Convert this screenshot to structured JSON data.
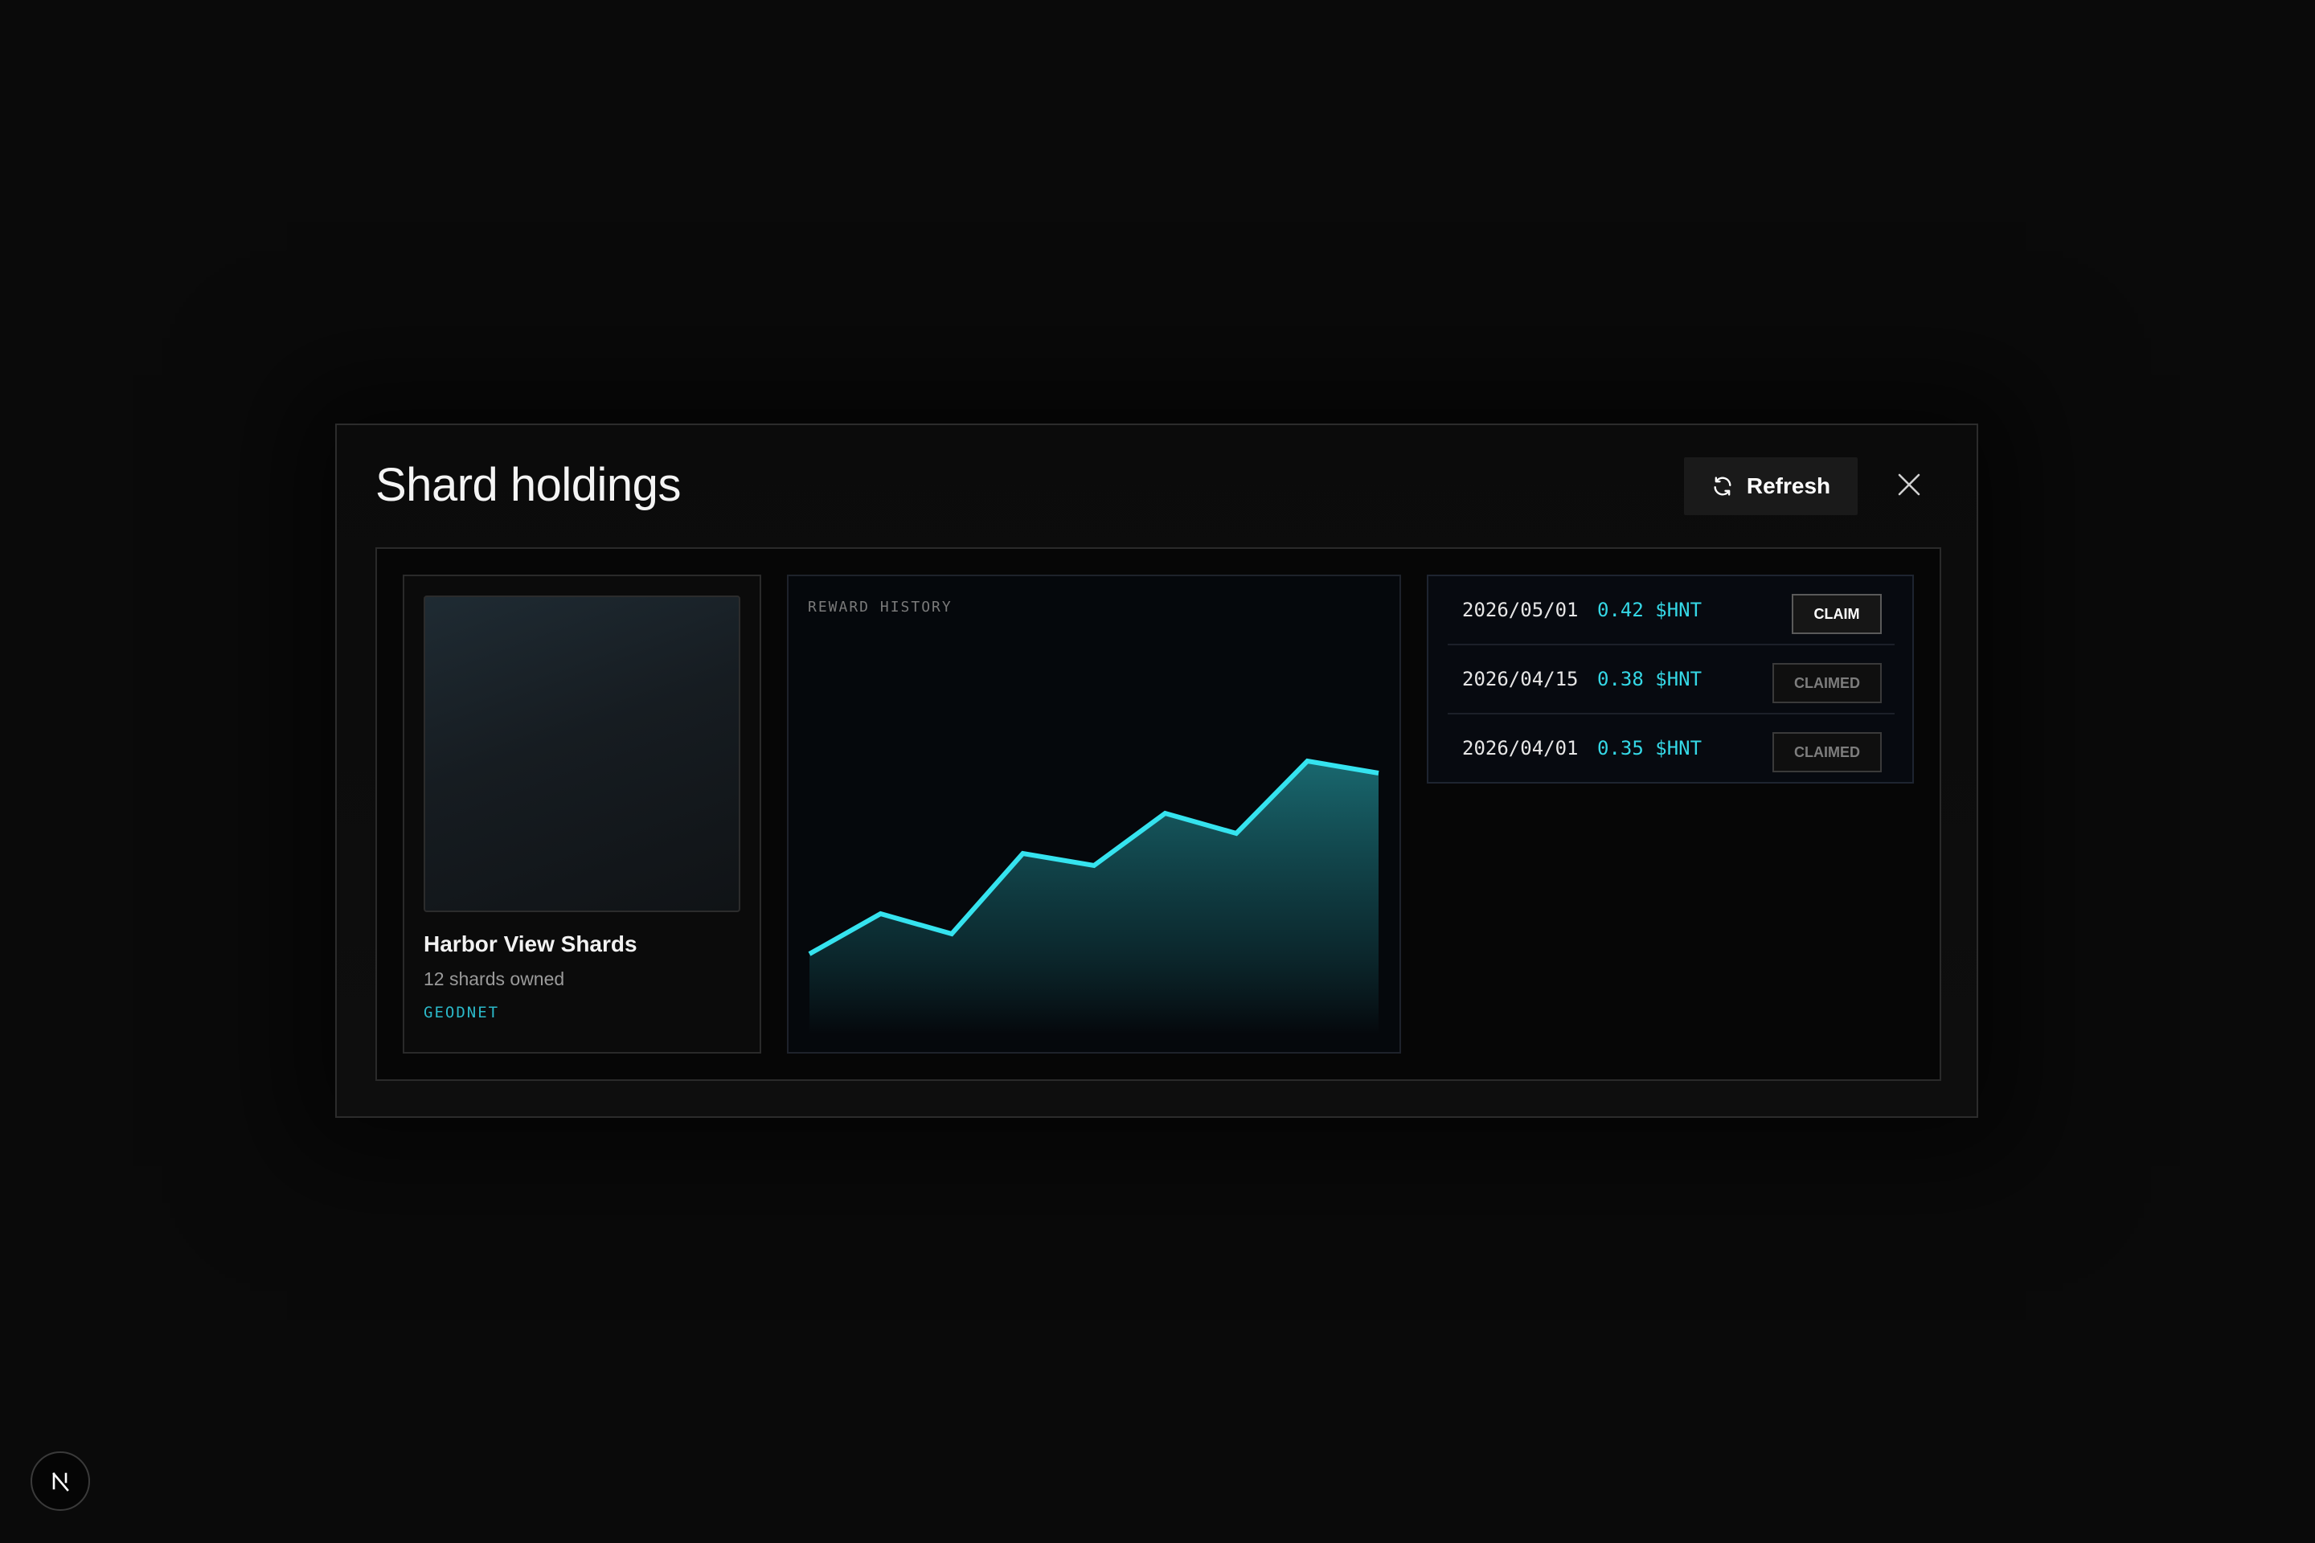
{
  "modal": {
    "title": "Shard holdings",
    "refresh_label": "Refresh"
  },
  "holding": {
    "name": "Harbor View Shards",
    "shards_owned": "12 shards owned",
    "network": "GEODNET"
  },
  "chart_data": {
    "type": "area",
    "title": "REWARD HISTORY",
    "xlabel": "",
    "ylabel": "",
    "x": [
      1,
      2,
      3,
      4,
      5,
      6,
      7,
      8,
      9
    ],
    "values": [
      0.2,
      0.3,
      0.25,
      0.45,
      0.42,
      0.55,
      0.5,
      0.68,
      0.65
    ],
    "ylim": [
      0,
      1
    ],
    "grid": false,
    "color": "#35e3ef"
  },
  "rewards": [
    {
      "date": "2026/05/01",
      "amount": "0.42 $HNT",
      "action": "CLAIM",
      "status": "claimable"
    },
    {
      "date": "2026/04/15",
      "amount": "0.38 $HNT",
      "action": "CLAIMED",
      "status": "claimed"
    },
    {
      "date": "2026/04/01",
      "amount": "0.35 $HNT",
      "action": "CLAIMED",
      "status": "claimed"
    }
  ],
  "colors": {
    "accent": "#35d8e6",
    "background": "#0a0a0a",
    "network_tag": "#2bb9c9"
  },
  "icons": {
    "refresh": "refresh-icon",
    "close": "close-icon",
    "framework_badge": "next-logo-icon"
  }
}
